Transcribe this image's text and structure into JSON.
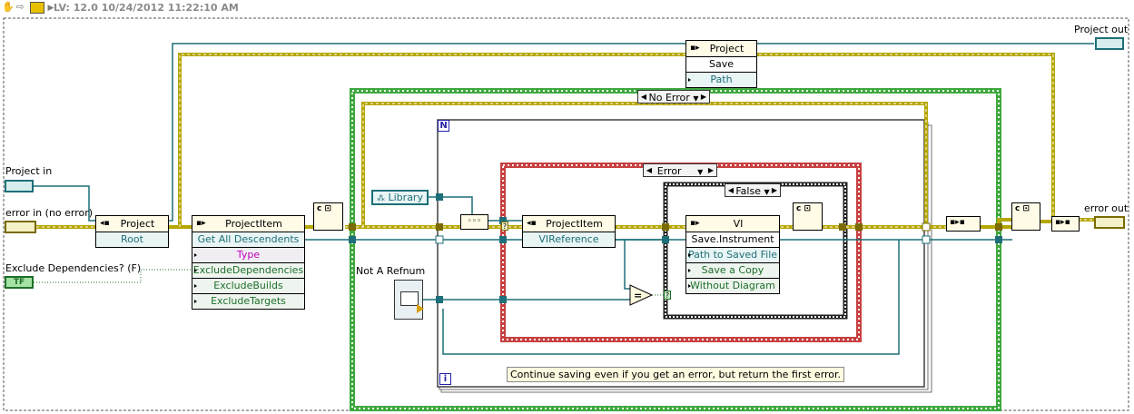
{
  "title_bar": {
    "version_text": "LV: 12.0 10/24/2012 11:22:10 AM"
  },
  "terminals": {
    "project_in": "Project in",
    "error_in": "error in (no error)",
    "exclude_dependencies": "Exclude Dependencies? (F)",
    "project_out": "Project out",
    "error_out": "error out",
    "not_a_refnum": "Not A Refnum",
    "tf_label": "TF"
  },
  "nodes": {
    "project_root": {
      "class": "Project",
      "property": "Root"
    },
    "project_item_method": {
      "class": "ProjectItem",
      "method": "Get All Descendents",
      "params": [
        "Type",
        "ExcludeDependencies",
        "ExcludeBuilds",
        "ExcludeTargets"
      ]
    },
    "project_save": {
      "class": "Project",
      "method": "Save",
      "param": "Path"
    },
    "project_item_ref": {
      "class": "ProjectItem",
      "property": "VIReference"
    },
    "vi_save": {
      "class": "VI",
      "method": "Save.Instrument",
      "params": [
        "Path to Saved File",
        "Save a Copy",
        "Without Diagram"
      ]
    },
    "library_constant": "Library"
  },
  "structures": {
    "outer_case": "No Error",
    "for_loop_count": "N",
    "for_loop_index": "i",
    "error_case": "Error",
    "bool_case": "False"
  },
  "comment": "Continue saving even if you get an error, but return the first error.",
  "colors": {
    "error_wire": "#b5a600",
    "refnum_wire": "#1d6f79",
    "bool_wire": "#1c6f29",
    "case_green": "#3ea83e",
    "case_red": "#c84040",
    "loop_gray": "#707070"
  }
}
